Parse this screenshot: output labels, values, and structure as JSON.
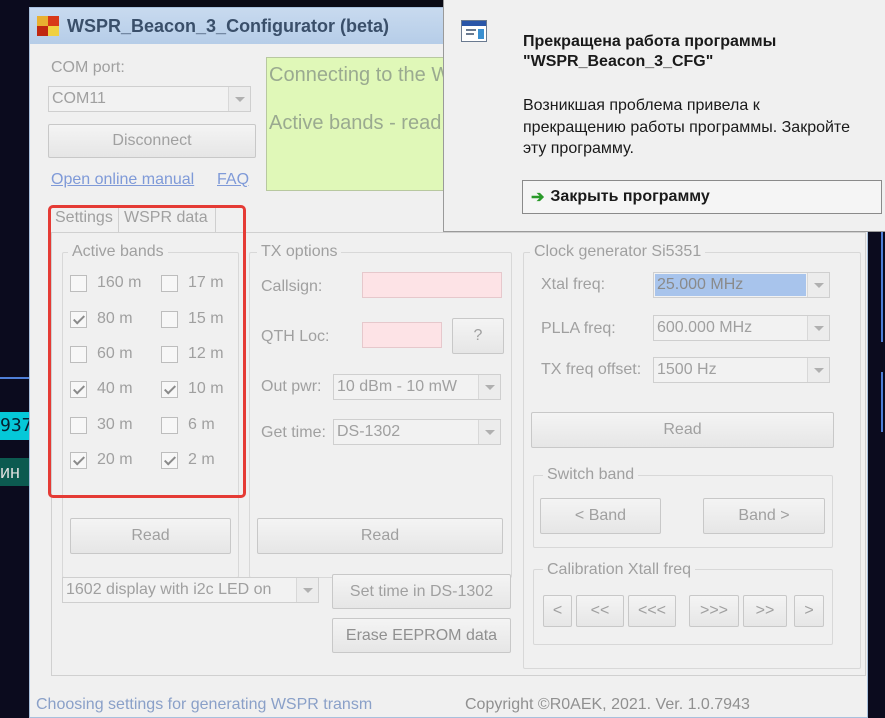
{
  "background": {
    "digits": "937",
    "teal_text": "ин"
  },
  "window": {
    "title": "WSPR_Beacon_3_Configurator (beta)"
  },
  "connection": {
    "com_port_label": "COM port:",
    "com_port_value": "COM11",
    "disconnect_label": "Disconnect",
    "manual_link": "Open online manual",
    "faq_link": "FAQ",
    "status_line1": "Connecting to the W",
    "status_line2": "Active bands - read"
  },
  "tabs": [
    {
      "label": "Settings"
    },
    {
      "label": "WSPR data"
    }
  ],
  "active_bands": {
    "title": "Active bands",
    "bands": [
      {
        "label": "160 m",
        "checked": false
      },
      {
        "label": "17 m",
        "checked": false
      },
      {
        "label": "80 m",
        "checked": true
      },
      {
        "label": "15 m",
        "checked": false
      },
      {
        "label": "60 m",
        "checked": false
      },
      {
        "label": "12 m",
        "checked": false
      },
      {
        "label": "40 m",
        "checked": true
      },
      {
        "label": "10 m",
        "checked": true
      },
      {
        "label": "30 m",
        "checked": false
      },
      {
        "label": "6 m",
        "checked": false
      },
      {
        "label": "20 m",
        "checked": true
      },
      {
        "label": "2 m",
        "checked": true
      }
    ],
    "read_label": "Read"
  },
  "tx_options": {
    "title": "TX options",
    "callsign_label": "Callsign:",
    "callsign_value": "",
    "qth_label": "QTH Loc:",
    "qth_value": "",
    "qth_help_label": "?",
    "out_pwr_label": "Out pwr:",
    "out_pwr_value": "10 dBm - 10 mW",
    "get_time_label": "Get time:",
    "get_time_value": "DS-1302",
    "read_label": "Read"
  },
  "clock_gen": {
    "title": "Clock generator Si5351",
    "xtal_label": "Xtal freq:",
    "xtal_value": "25.000 MHz",
    "plla_label": "PLLA freq:",
    "plla_value": "600.000 MHz",
    "offset_label": "TX freq offset:",
    "offset_value": "1500 Hz",
    "read_label": "Read",
    "switch_band_title": "Switch band",
    "prev_band_label": "< Band",
    "next_band_label": "Band >",
    "calibration_title": "Calibration Xtall freq",
    "cal_buttons": [
      "<",
      "<<",
      "<<<",
      ">>>",
      ">>",
      ">"
    ]
  },
  "bottom": {
    "display_value": "1602 display with i2c LED on",
    "set_time_label": "Set time in DS-1302",
    "erase_label": "Erase EEPROM data"
  },
  "statusbar": {
    "left": "Choosing settings for generating WSPR transmission",
    "right": "Copyright ©R0AEK, 2021. Ver. 1.0.7943"
  },
  "crash_dialog": {
    "title_line1": "Прекращена работа программы",
    "title_line2": "\"WSPR_Beacon_3_CFG\"",
    "message_line1": "Возникшая проблема привела к",
    "message_line2": "прекращению работы программы. Закройте",
    "message_line3": "эту программу.",
    "close_label": "Закрыть программу"
  },
  "colors": {
    "highlight_box": "#e53b35",
    "status_panel": "#e0f8b8",
    "xtal_selected": "#a8c4ec",
    "pink_field": "#fde3e6"
  }
}
